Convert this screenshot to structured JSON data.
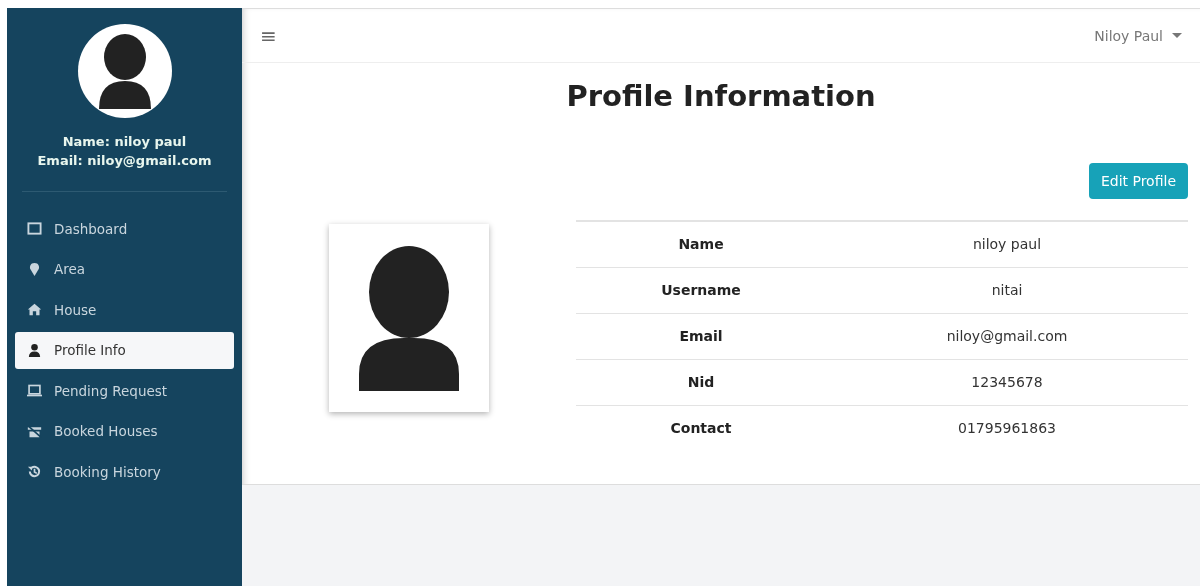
{
  "sidebar": {
    "user_name": "Name: niloy paul",
    "user_email": "Email: niloy@gmail.com",
    "items": [
      {
        "label": "Dashboard",
        "selected": false
      },
      {
        "label": "Area",
        "selected": false
      },
      {
        "label": "House",
        "selected": false
      },
      {
        "label": "Profile Info",
        "selected": true
      },
      {
        "label": "Pending Request",
        "selected": false
      },
      {
        "label": "Booked Houses",
        "selected": false
      },
      {
        "label": "Booking History",
        "selected": false
      }
    ]
  },
  "navbar": {
    "menu_glyph": "≡",
    "user_menu": "Niloy Paul"
  },
  "page": {
    "title": "Profile Information",
    "edit_button": "Edit Profile",
    "details": [
      {
        "label": "Name",
        "value": "niloy paul"
      },
      {
        "label": "Username",
        "value": "nitai"
      },
      {
        "label": "Email",
        "value": "niloy@gmail.com"
      },
      {
        "label": "Nid",
        "value": "12345678"
      },
      {
        "label": "Contact",
        "value": "01795961863"
      }
    ]
  }
}
